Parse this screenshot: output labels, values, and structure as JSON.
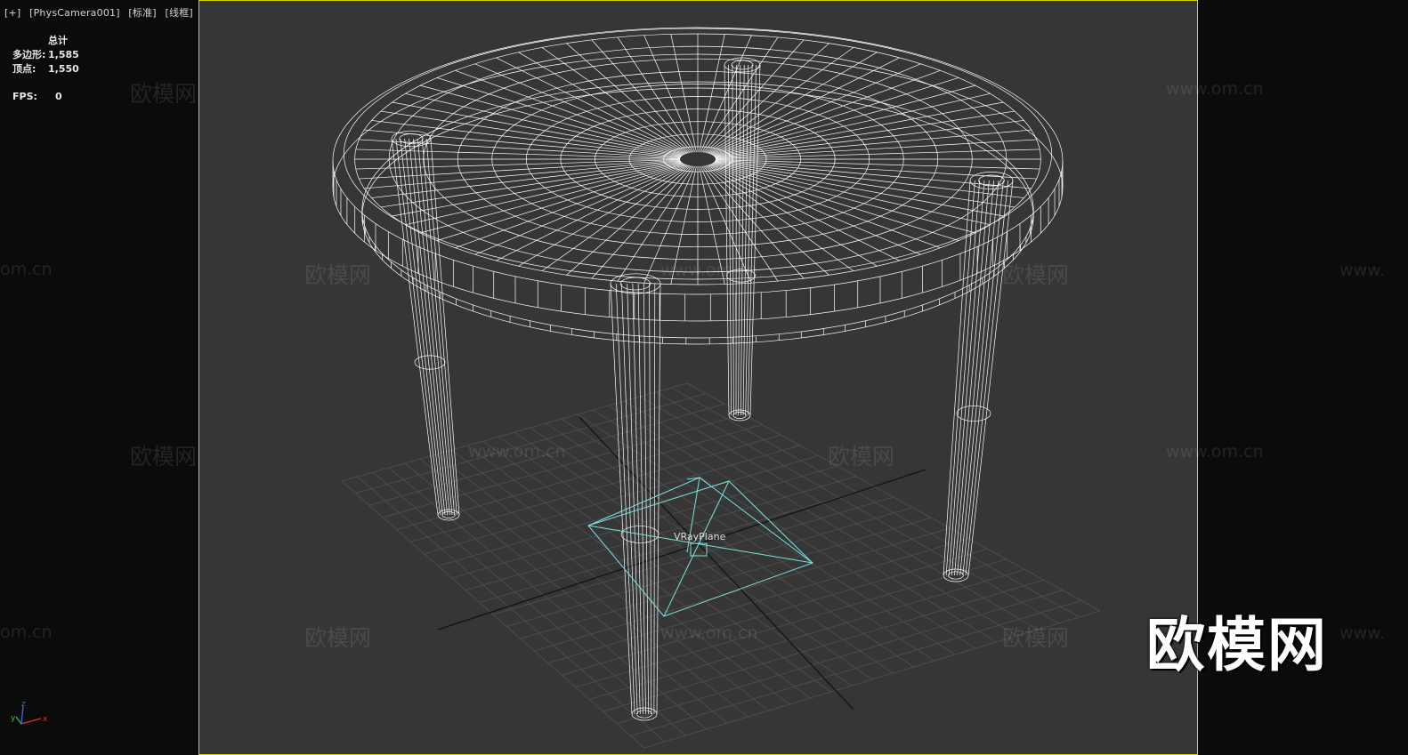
{
  "viewport": {
    "labels": [
      "[+]",
      "[PhysCamera001]",
      "[标准]",
      "[线框]"
    ],
    "active_border_color": "#d9d000",
    "background_color": "#363636"
  },
  "stats": {
    "header": "总计",
    "polygons_label": "多边形:",
    "polygons_value": "1,585",
    "vertices_label": "顶点:",
    "vertices_value": "1,550",
    "fps_label": "FPS:",
    "fps_value": "0"
  },
  "scene": {
    "object_label": "VRayPlane",
    "object_color": "#7fe0e0",
    "wire_color": "#ffffff",
    "grid_color": "#4a4a4a"
  },
  "axis_gizmo": {
    "x": "x",
    "y": "y",
    "z": "z"
  },
  "watermarks": {
    "logo": "欧模网",
    "url": "www.om.cn",
    "url_fragment": "om.cn",
    "url_fragment_left": "www."
  }
}
